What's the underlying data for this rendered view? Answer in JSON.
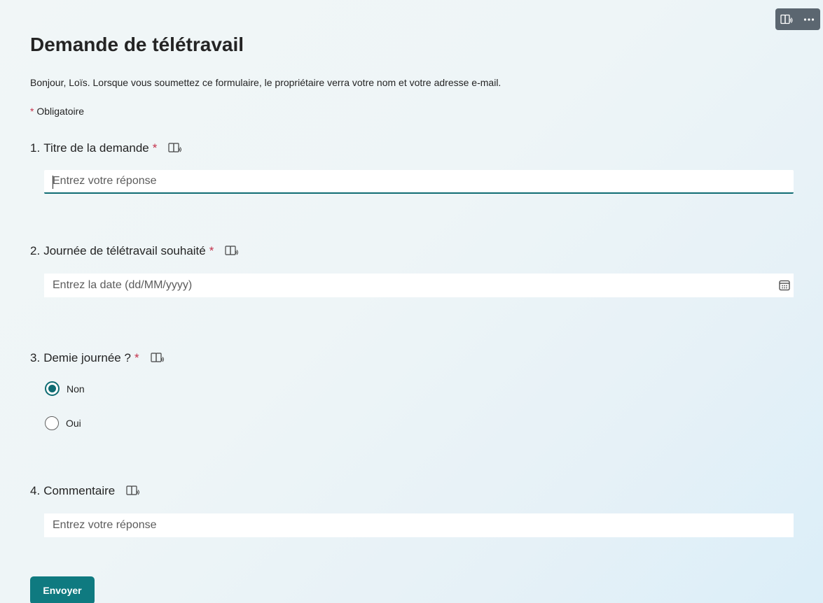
{
  "toolbar": {
    "immersive_reader_icon": "immersive-reader-icon",
    "more_icon": "more-options-icon"
  },
  "form": {
    "title": "Demande de télétravail",
    "greeting": "Bonjour, Loïs. Lorsque vous soumettez ce formulaire, le propriétaire verra votre nom et votre adresse e-mail.",
    "required_star": "*",
    "required_label": "Obligatoire"
  },
  "questions": [
    {
      "number": "1.",
      "label": "Titre de la demande",
      "required": "*",
      "type": "text",
      "placeholder": "Entrez votre réponse",
      "value": ""
    },
    {
      "number": "2.",
      "label": "Journée de télétravail souhaité",
      "required": "*",
      "type": "date",
      "placeholder": "Entrez la date (dd/MM/yyyy)",
      "value": ""
    },
    {
      "number": "3.",
      "label": "Demie journée ?",
      "required": "*",
      "type": "radio",
      "options": [
        {
          "label": "Non",
          "selected": true
        },
        {
          "label": "Oui",
          "selected": false
        }
      ]
    },
    {
      "number": "4.",
      "label": "Commentaire",
      "required": "",
      "type": "text",
      "placeholder": "Entrez votre réponse",
      "value": ""
    }
  ],
  "submit": {
    "label": "Envoyer"
  },
  "colors": {
    "accent": "#0f6c73",
    "button": "#0f7a80",
    "required": "#c4314b",
    "toolbar_bg": "#5b6670"
  }
}
